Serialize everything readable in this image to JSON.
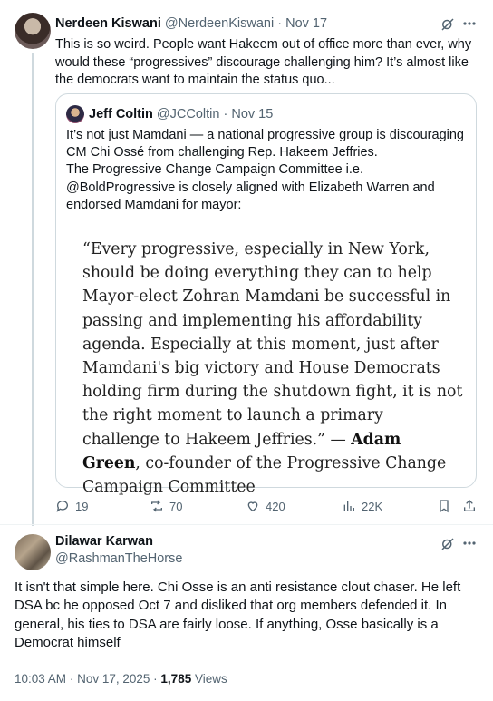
{
  "tweet": {
    "author_name": "Nerdeen Kiswani",
    "handle": "@NerdeenKiswani",
    "separator": "·",
    "date": "Nov 17",
    "text": "This is so weird. People want Hakeem out of office more than ever, why would these “progressives” discourage challenging him? It’s almost like the democrats want to maintain the status quo...",
    "quote": {
      "author_name": "Jeff Coltin",
      "handle": "@JCColtin",
      "separator": "·",
      "date": "Nov 15",
      "text": "It’s not just Mamdani — a national progressive group is discouraging CM Chi Ossé from challenging Rep. Hakeem Jeffries.\nThe Progressive Change Campaign Committee i.e. @BoldProgressive is closely aligned with Elizabeth Warren and endorsed Mamdani for mayor:",
      "quote_main": "“Every progressive, especially in New York, should be doing everything they can to help Mayor-elect Zohran Mamdani be successful in passing and implementing his affordability agenda. Especially at this moment, just after Mamdani's big victory and House Democrats holding firm during the shutdown fight, it is not the right moment to launch a primary challenge to Hakeem Jeffries.” —",
      "quote_attrib_name": "Adam Green",
      "quote_attrib_rest": ", co-founder of the Progressive Change Campaign Committee"
    },
    "actions": {
      "replies": "19",
      "reposts": "70",
      "likes": "420",
      "views": "22K"
    }
  },
  "reply": {
    "author_name": "Dilawar Karwan",
    "handle": "@RashmanTheHorse",
    "text": "It isn't that simple here. Chi Osse is an anti resistance clout chaser. He left DSA bc he opposed Oct 7 and disliked that org members defended it. In general, his ties to DSA are fairly loose. If anything, Osse basically is a Democrat himself",
    "time": "10:03 AM",
    "separator": "·",
    "date": "Nov 17, 2025",
    "views_count": "1,785",
    "views_label": "Views"
  },
  "icons": {
    "grok": "grok-icon",
    "more": "more-icon",
    "reply": "reply-icon",
    "repost": "repost-icon",
    "like": "heart-icon",
    "views": "views-icon",
    "bookmark": "bookmark-icon",
    "share": "share-icon"
  },
  "colors": {
    "text": "#0f1419",
    "muted": "#536471",
    "border": "#cfd9de"
  }
}
